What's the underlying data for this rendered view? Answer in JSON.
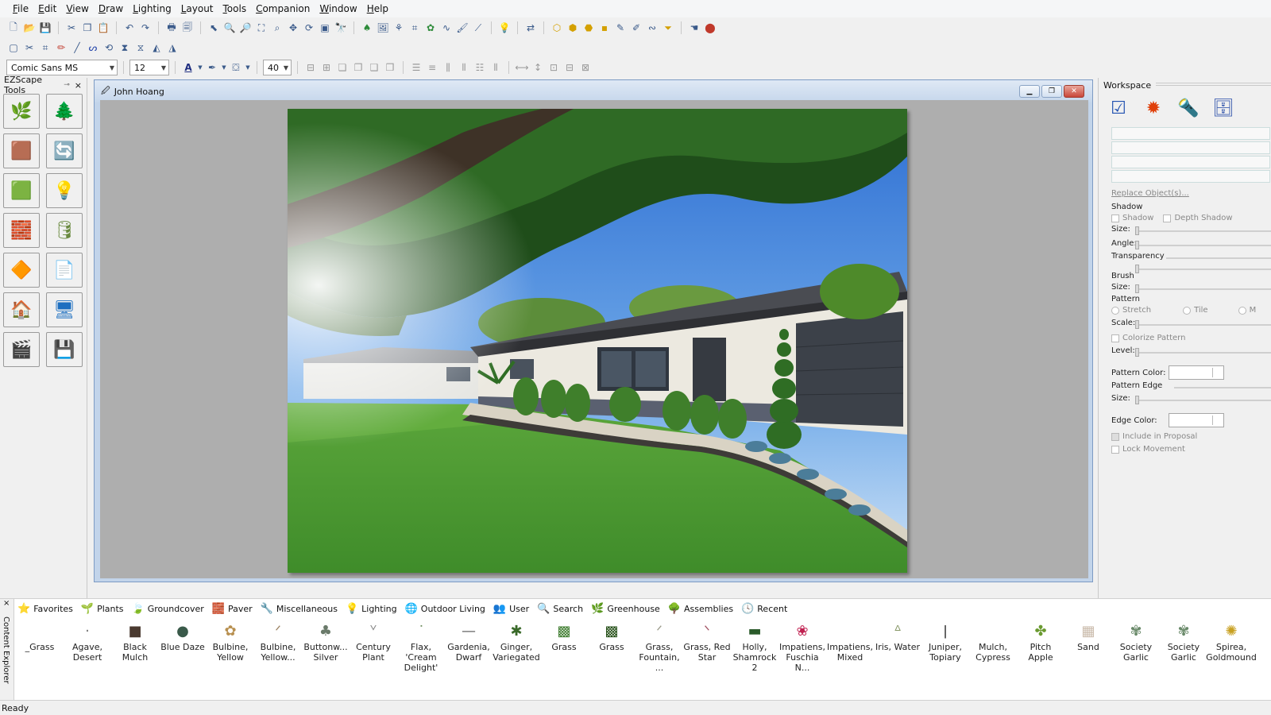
{
  "menu": [
    "File",
    "Edit",
    "View",
    "Draw",
    "Lighting",
    "Layout",
    "Tools",
    "Companion",
    "Window",
    "Help"
  ],
  "format_toolbar": {
    "font": "Comic Sans MS",
    "font_size": "12",
    "zoom": "40"
  },
  "ezscape": {
    "title": "EZScape Tools",
    "close": "×",
    "tools": [
      {
        "name": "grass-paint",
        "icon": "🌿"
      },
      {
        "name": "add-plants",
        "icon": "🌲"
      },
      {
        "name": "mulch-paint",
        "icon": "🟫"
      },
      {
        "name": "replace-object",
        "icon": "🔄"
      },
      {
        "name": "ground-paint",
        "icon": "🟩"
      },
      {
        "name": "lighting",
        "icon": "💡"
      },
      {
        "name": "wall-paint",
        "icon": "🧱"
      },
      {
        "name": "material-database",
        "icon": "🛢"
      },
      {
        "name": "paver-paint",
        "icon": "🔶"
      },
      {
        "name": "report",
        "icon": "📄"
      },
      {
        "name": "home-image",
        "icon": "🏠"
      },
      {
        "name": "presentation",
        "icon": "🖥"
      },
      {
        "name": "video-help",
        "icon": "🎬"
      },
      {
        "name": "tablet-save",
        "icon": "💾"
      }
    ]
  },
  "document": {
    "title": "John Hoang"
  },
  "workspace": {
    "title": "Workspace",
    "replace_objects": "Replace Object(s)...",
    "shadow_header": "Shadow",
    "shadow_cb": "Shadow",
    "depth_shadow_cb": "Depth Shadow",
    "size_label": "Size:",
    "angle_label": "Angle:",
    "transparency_label": "Transparency",
    "brush_label": "Brush",
    "pattern_label": "Pattern",
    "stretch_label": "Stretch",
    "tile_label": "Tile",
    "m_label": "M",
    "scale_label": "Scale:",
    "colorize_label": "Colorize Pattern",
    "level_label": "Level:",
    "pattern_color_label": "Pattern Color:",
    "pattern_edge_label": "Pattern Edge",
    "edge_color_label": "Edge Color:",
    "include_label": "Include in Proposal",
    "lock_label": "Lock Movement"
  },
  "content": {
    "side_label": "Content Explorer",
    "close": "×",
    "tabs": [
      {
        "label": "Favorites",
        "icon": "⭐"
      },
      {
        "label": "Plants",
        "icon": "🌱"
      },
      {
        "label": "Groundcover",
        "icon": "🍃"
      },
      {
        "label": "Paver",
        "icon": "🧱"
      },
      {
        "label": "Miscellaneous",
        "icon": "🔧"
      },
      {
        "label": "Lighting",
        "icon": "💡"
      },
      {
        "label": "Outdoor Living",
        "icon": "🌐"
      },
      {
        "label": "User",
        "icon": "👥"
      },
      {
        "label": "Search",
        "icon": "🔍"
      },
      {
        "label": "Greenhouse",
        "icon": "🌿"
      },
      {
        "label": "Assemblies",
        "icon": "🌳"
      },
      {
        "label": "Recent",
        "icon": "🕓"
      }
    ],
    "items": [
      {
        "l1": "_Grass",
        "l2": "",
        "icon": ""
      },
      {
        "l1": "Agave,",
        "l2": "Desert",
        "icon": "·"
      },
      {
        "l1": "Black",
        "l2": "Mulch",
        "icon": "■"
      },
      {
        "l1": "Blue Daze",
        "l2": "",
        "icon": "●"
      },
      {
        "l1": "Bulbine,",
        "l2": "Yellow",
        "icon": "✿"
      },
      {
        "l1": "Bulbine,",
        "l2": "Yellow...",
        "icon": "ᐟ"
      },
      {
        "l1": "Buttonw...",
        "l2": "Silver",
        "icon": "♣"
      },
      {
        "l1": "Century",
        "l2": "Plant",
        "icon": "ᘁ"
      },
      {
        "l1": "Flax, 'Cream",
        "l2": "Delight'",
        "icon": "ᐝ"
      },
      {
        "l1": "Gardenia,",
        "l2": "Dwarf",
        "icon": "—"
      },
      {
        "l1": "Ginger,",
        "l2": "Variegated",
        "icon": "✱"
      },
      {
        "l1": "Grass",
        "l2": "",
        "icon": "▩"
      },
      {
        "l1": "Grass",
        "l2": "",
        "icon": "▩"
      },
      {
        "l1": "Grass,",
        "l2": "Fountain, ...",
        "icon": "ᐟ"
      },
      {
        "l1": "Grass, Red",
        "l2": "Star",
        "icon": "ᐠ"
      },
      {
        "l1": "Holly,",
        "l2": "Shamrock 2",
        "icon": "▬"
      },
      {
        "l1": "Impatiens,",
        "l2": "Fuschia N...",
        "icon": "❀"
      },
      {
        "l1": "Impatiens,",
        "l2": "Mixed",
        "icon": ""
      },
      {
        "l1": "Iris, Water",
        "l2": "",
        "icon": "ᐞ"
      },
      {
        "l1": "Juniper,",
        "l2": "Topiary",
        "icon": "ǀ"
      },
      {
        "l1": "Mulch,",
        "l2": "Cypress",
        "icon": ""
      },
      {
        "l1": "Pitch Apple",
        "l2": "",
        "icon": "✤"
      },
      {
        "l1": "Sand",
        "l2": "",
        "icon": "▦"
      },
      {
        "l1": "Society",
        "l2": "Garlic",
        "icon": "✾"
      },
      {
        "l1": "Society",
        "l2": "Garlic",
        "icon": "✾"
      },
      {
        "l1": "Spirea,",
        "l2": "Goldmound",
        "icon": "✺"
      }
    ]
  },
  "status": "Ready"
}
